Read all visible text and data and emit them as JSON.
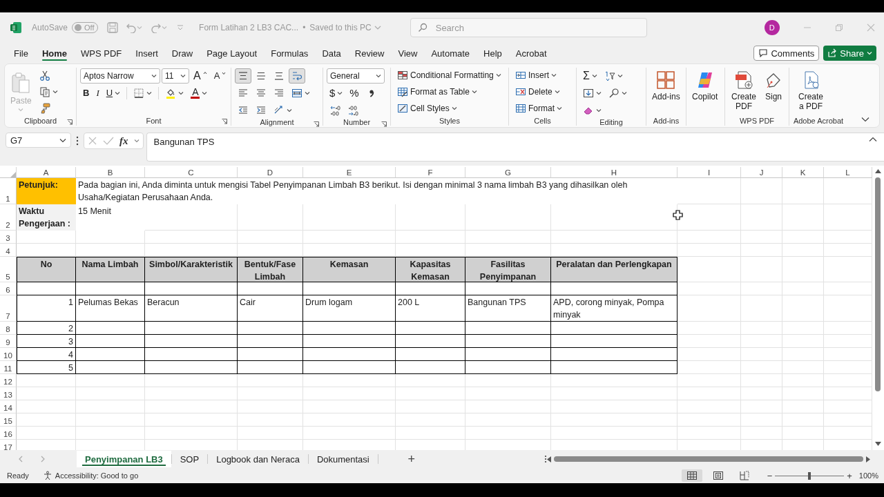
{
  "title_bar": {
    "autosave_label": "AutoSave",
    "autosave_on": false,
    "autosave_state": "Off",
    "document_title": "Form Latihan 2 LB3 CAC...",
    "separator": "•",
    "save_status": "Saved to this PC",
    "search_placeholder": "Search",
    "account_initial": "D"
  },
  "menu_tabs": [
    {
      "label": "File",
      "selected": false
    },
    {
      "label": "Home",
      "selected": true
    },
    {
      "label": "WPS PDF",
      "selected": false
    },
    {
      "label": "Insert",
      "selected": false
    },
    {
      "label": "Draw",
      "selected": false
    },
    {
      "label": "Page Layout",
      "selected": false
    },
    {
      "label": "Formulas",
      "selected": false
    },
    {
      "label": "Data",
      "selected": false
    },
    {
      "label": "Review",
      "selected": false
    },
    {
      "label": "View",
      "selected": false
    },
    {
      "label": "Automate",
      "selected": false
    },
    {
      "label": "Help",
      "selected": false
    },
    {
      "label": "Acrobat",
      "selected": false
    }
  ],
  "comments_button": "Comments",
  "share_button": "Share",
  "ribbon": {
    "clipboard": {
      "paste": "Paste",
      "paste_disabled": true,
      "label": "Clipboard"
    },
    "font": {
      "font_name": "Aptos Narrow",
      "font_size": "11",
      "grow": "A",
      "shrink": "A",
      "bold": "B",
      "italic": "I",
      "underline": "U",
      "font_color": "A",
      "label": "Font"
    },
    "alignment": {
      "top_align_on": true,
      "wrap_text_on": true,
      "label": "Alignment"
    },
    "number": {
      "format": "General",
      "currency_symbol": "$",
      "percent_symbol": "%",
      "label": "Number"
    },
    "styles": {
      "conditional_formatting": "Conditional Formatting",
      "format_as_table": "Format as Table",
      "cell_styles": "Cell Styles",
      "label": "Styles"
    },
    "cells": {
      "insert": "Insert",
      "delete": "Delete",
      "format": "Format",
      "label": "Cells"
    },
    "editing": {
      "sum_symbol": "Σ",
      "label": "Editing"
    },
    "add_ins": {
      "button": "Add-ins",
      "label": "Add-ins"
    },
    "copilot": {
      "button": "Copilot"
    },
    "wps_pdf": {
      "create": "Create PDF",
      "sign": "Sign",
      "label": "WPS PDF"
    },
    "acrobat": {
      "create": "Create a PDF",
      "label": "Adobe Acrobat"
    }
  },
  "formula_bar": {
    "name_box": "G7",
    "fx": "fx",
    "formula": "Bangunan TPS"
  },
  "sheet": {
    "columns": [
      "A",
      "B",
      "C",
      "D",
      "E",
      "F",
      "G",
      "H",
      "I",
      "J",
      "K",
      "L"
    ],
    "row_numbers": [
      "1",
      "2",
      "3",
      "4",
      "5",
      "6",
      "7",
      "8",
      "9",
      "10",
      "11",
      "12",
      "13",
      "14",
      "15",
      "16",
      "17"
    ],
    "instructions": [
      {
        "label": "Petunjuk:",
        "text": "Pada bagian ini, Anda diminta untuk mengisi Tabel Penyimpanan Limbah B3 berikut. Isi dengan minimal 3 nama limbah B3 yang dihasilkan oleh Usaha/Kegiatan Perusahaan Anda.",
        "color": "#ffc000"
      },
      {
        "label": "Waktu Pengerjaan :",
        "text": "15 Menit",
        "color": "#f2f2f2"
      }
    ],
    "table": {
      "headers": [
        "No",
        "Nama Limbah",
        "Simbol/Karakteristik",
        "Bentuk/Fase Limbah",
        "Kemasan",
        "Kapasitas Kemasan",
        "Fasilitas Penyimpanan",
        "Peralatan dan Perlengkapan"
      ],
      "rows": [
        {
          "no": "1",
          "cells": [
            "Pelumas Bekas",
            "Beracun",
            "Cair",
            "Drum logam",
            "200 L",
            "Bangunan TPS",
            "APD, corong minyak, Pompa minyak"
          ]
        },
        {
          "no": "2"
        },
        {
          "no": "3"
        },
        {
          "no": "4"
        },
        {
          "no": "5"
        }
      ]
    }
  },
  "sheet_tabs": [
    {
      "label": "Penyimpanan LB3",
      "selected": true
    },
    {
      "label": "SOP",
      "selected": false
    },
    {
      "label": "Logbook dan Neraca",
      "selected": false
    },
    {
      "label": "Dokumentasi",
      "selected": false
    }
  ],
  "add_sheet": "+",
  "status_bar": {
    "status": "Ready",
    "accessibility": "Accessibility: Good to go",
    "views": [
      {
        "kind": "normal",
        "selected": true
      },
      {
        "kind": "page_layout",
        "selected": false
      },
      {
        "kind": "page_break",
        "selected": false
      }
    ],
    "zoom_minus": "−",
    "zoom_slider": {
      "level": 0.5
    },
    "zoom_plus": "+",
    "zoom": "100%"
  }
}
